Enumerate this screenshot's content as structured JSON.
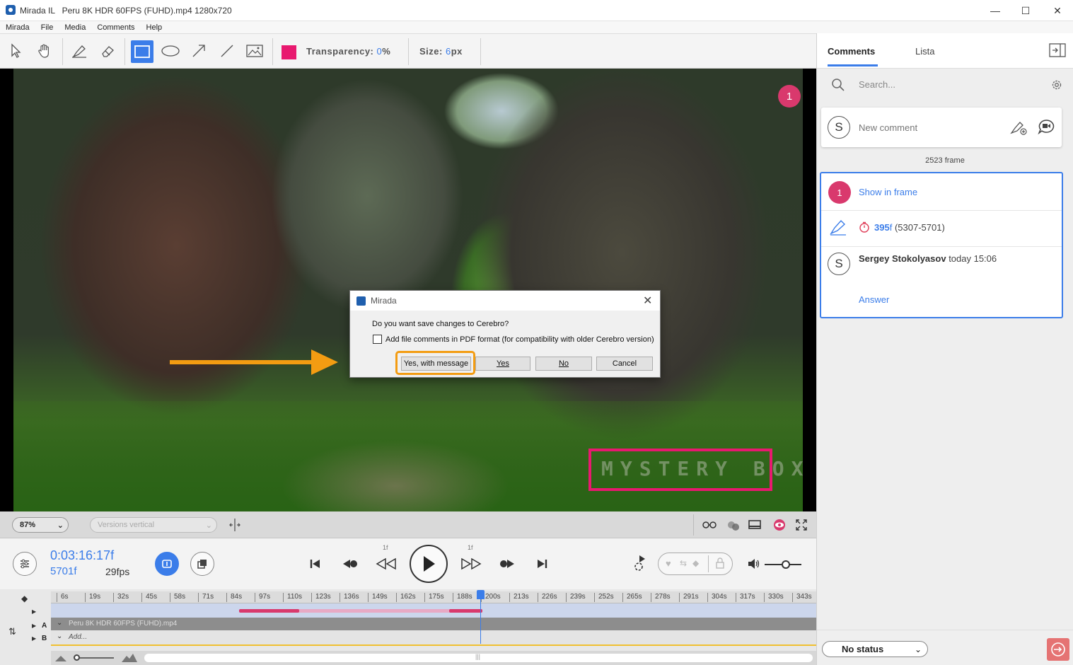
{
  "window": {
    "app_name": "Mirada IL",
    "file_title": "Peru 8K HDR 60FPS (FUHD).mp4 1280x720",
    "minimize": "—",
    "maximize": "☐",
    "close": "✕"
  },
  "menu": [
    "Mirada",
    "File",
    "Media",
    "Comments",
    "Help"
  ],
  "toolbar": {
    "color": "#e8196f",
    "transparency_label": "Transparency:",
    "transparency_value": "0",
    "transparency_unit": "%",
    "size_label": "Size:",
    "size_value": "6",
    "size_unit": "px",
    "tools": [
      "cursor-icon",
      "hand-icon",
      "brush-icon",
      "eraser-icon",
      "rectangle-icon",
      "ellipse-icon",
      "arrow-icon",
      "line-icon",
      "image-icon"
    ],
    "active_tool": "rectangle-icon"
  },
  "video": {
    "marker_number": "1",
    "watermark": "MYSTERY BOX"
  },
  "dialog": {
    "title": "Mirada",
    "question": "Do you want save changes to Cerebro?",
    "checkbox_label": "Add file comments in PDF format (for compatibility with older Cerebro version)",
    "checkbox_checked": false,
    "buttons": {
      "yes_with_message": "Yes, with message",
      "yes": "Yes",
      "no": "No",
      "cancel": "Cancel"
    }
  },
  "view": {
    "zoom": "87%",
    "versions": "Versions vertical"
  },
  "player": {
    "timecode": "0:03:16:17f",
    "frame": "5701f",
    "fps": "29fps",
    "step_back_label": "1f",
    "step_fwd_label": "1f"
  },
  "timeline": {
    "ticks": [
      "6s",
      "19s",
      "32s",
      "45s",
      "58s",
      "71s",
      "84s",
      "97s",
      "110s",
      "123s",
      "136s",
      "149s",
      "162s",
      "175s",
      "188s",
      "200s",
      "213s",
      "226s",
      "239s",
      "252s",
      "265s",
      "278s",
      "291s",
      "304s",
      "317s",
      "330s",
      "343s"
    ],
    "track_a_label": "A",
    "track_b_label": "B",
    "track_a_name": "Peru 8K HDR 60FPS (FUHD).mp4",
    "track_b_name": "Add..."
  },
  "panel": {
    "tabs": [
      "Comments",
      "Lista"
    ],
    "active_tab": "Comments",
    "search_placeholder": "Search...",
    "avatar_letter": "S",
    "new_comment_placeholder": "New comment",
    "frame_label": "2523 frame",
    "comment": {
      "number": "1",
      "show_in_frame": "Show in frame",
      "duration_value": "395",
      "duration_unit": "f",
      "duration_range": "(5307-5701)",
      "author": "Sergey Stokolyasov",
      "time": "today 15:06",
      "answer": "Answer"
    },
    "status": "No status"
  },
  "colors": {
    "accent": "#3b7de9",
    "marker": "#d9396d",
    "highlight": "#f39c12",
    "annotation": "#e8196f"
  }
}
